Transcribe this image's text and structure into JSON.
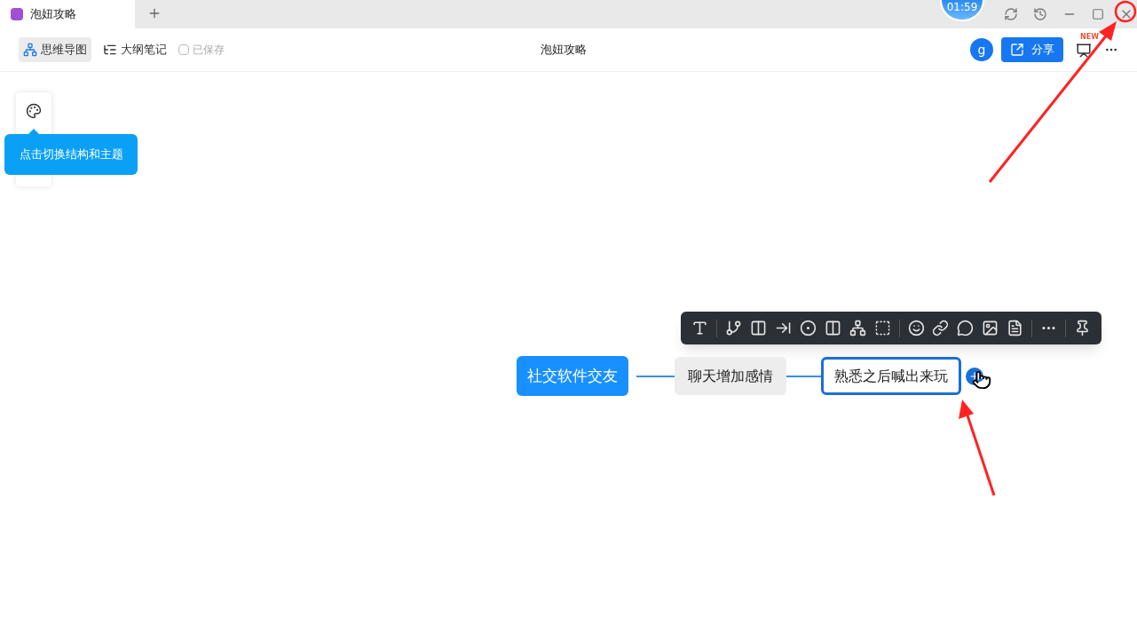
{
  "tabs": [
    {
      "title": "泡妞攻略",
      "selected": true
    }
  ],
  "timer": "01:59",
  "view_switch": [
    {
      "label": "思维导图",
      "kind": "mindmap",
      "selected": true
    },
    {
      "label": "大纲笔记",
      "kind": "outline",
      "selected": false
    }
  ],
  "save_status": "已保存",
  "document_title": "泡妞攻略",
  "avatar": "g",
  "share_button": "分享",
  "new_badge": "NEW",
  "tooltip": "点击切换结构和主题",
  "mindmap": {
    "root": "社交软件交友",
    "children": [
      {
        "label": "聊天增加感情",
        "selected": false,
        "children": [
          {
            "label": "熟悉之后喊出来玩",
            "selected": true
          }
        ]
      }
    ]
  }
}
